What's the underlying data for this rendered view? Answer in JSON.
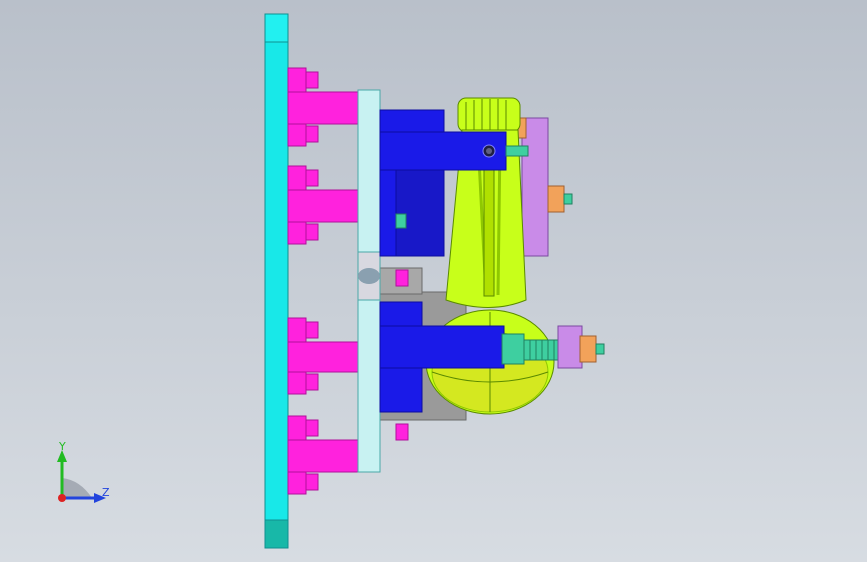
{
  "viewport": {
    "background_top": "#b9c0ca",
    "background_bottom": "#d7dce2"
  },
  "triad": {
    "y_label": "Y",
    "z_label": "Z",
    "y_color": "#22bb22",
    "z_color": "#2244dd",
    "origin_color": "#dd2222"
  },
  "colors": {
    "base_plate": "#18e8e8",
    "base_plate_edge": "#0f8f8f",
    "bolt": "#ff22dd",
    "bolt_dark": "#b0109a",
    "mount_plate": "#c8f2f2",
    "clamp_block": "#1a1ae8",
    "clamp_dark": "#0c0ca0",
    "part_body": "#c8ff1a",
    "part_shade": "#8fc800",
    "grey_block": "#9a9a9a",
    "purple_block": "#c98be8",
    "nut": "#f2a25a",
    "screw": "#3ecfa0"
  }
}
